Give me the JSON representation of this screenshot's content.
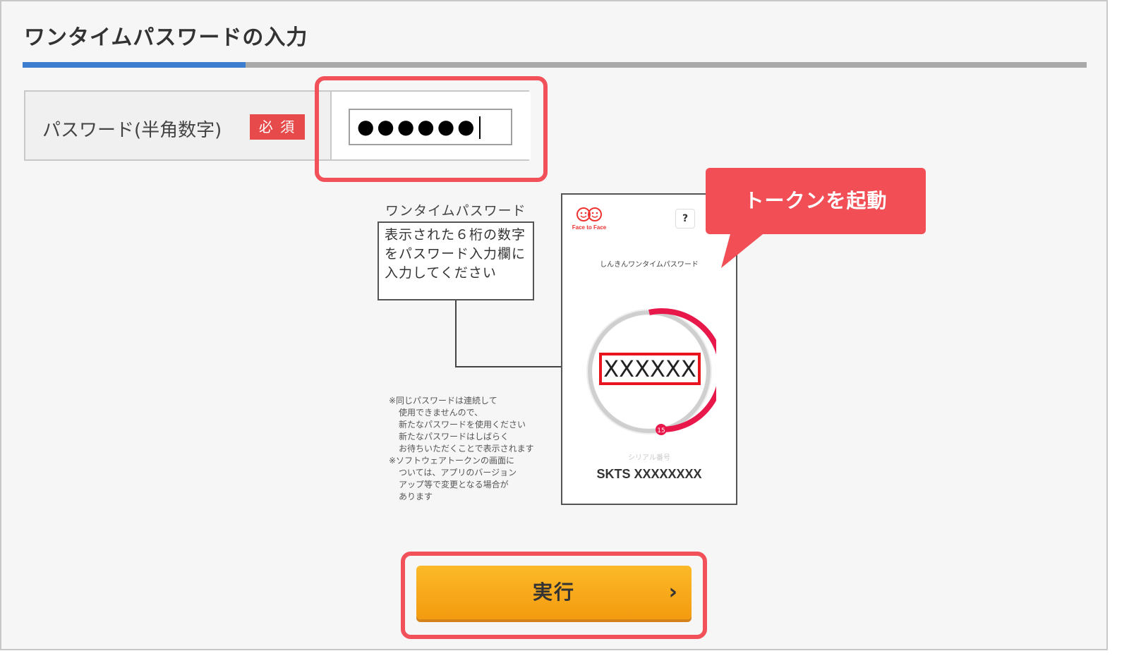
{
  "page": {
    "title": "ワンタイムパスワードの入力"
  },
  "form": {
    "password_label": "パスワード(半角数字)",
    "required_badge": "必 須",
    "password_value": "●●●●●●"
  },
  "diagram": {
    "heading": "ワンタイムパスワード",
    "instruction_lines": [
      "表示された６桁の数字",
      "をパスワード入力欄に",
      "入力してください"
    ],
    "notes": [
      "※同じパスワードは連続して",
      "使用できませんので、",
      "新たなパスワードを使用ください",
      "新たなパスワードはしばらく",
      "お待ちいただくことで表示されます",
      "※ソフトウェアトークンの画面に",
      "ついては、アプリのバージョン",
      "アップ等で変更となる場合が",
      "あります"
    ],
    "phone": {
      "logo_text": "Face to Face",
      "help_label": "?",
      "app_title": "しんきんワンタイムパスワード",
      "code": "XXXXXX",
      "timer": "15",
      "serial_label": "シリアル番号",
      "serial_value": "SKTS XXXXXXXX"
    },
    "callout": "トークンを起動"
  },
  "actions": {
    "execute_label": "実行",
    "execute_icon": "chevron-right-icon"
  },
  "colors": {
    "accent_blue": "#3d7dd0",
    "highlight_red": "#f2515a",
    "badge_red": "#e64a4a",
    "button_orange": "#f7a91c",
    "ring_red": "#e8184a"
  }
}
